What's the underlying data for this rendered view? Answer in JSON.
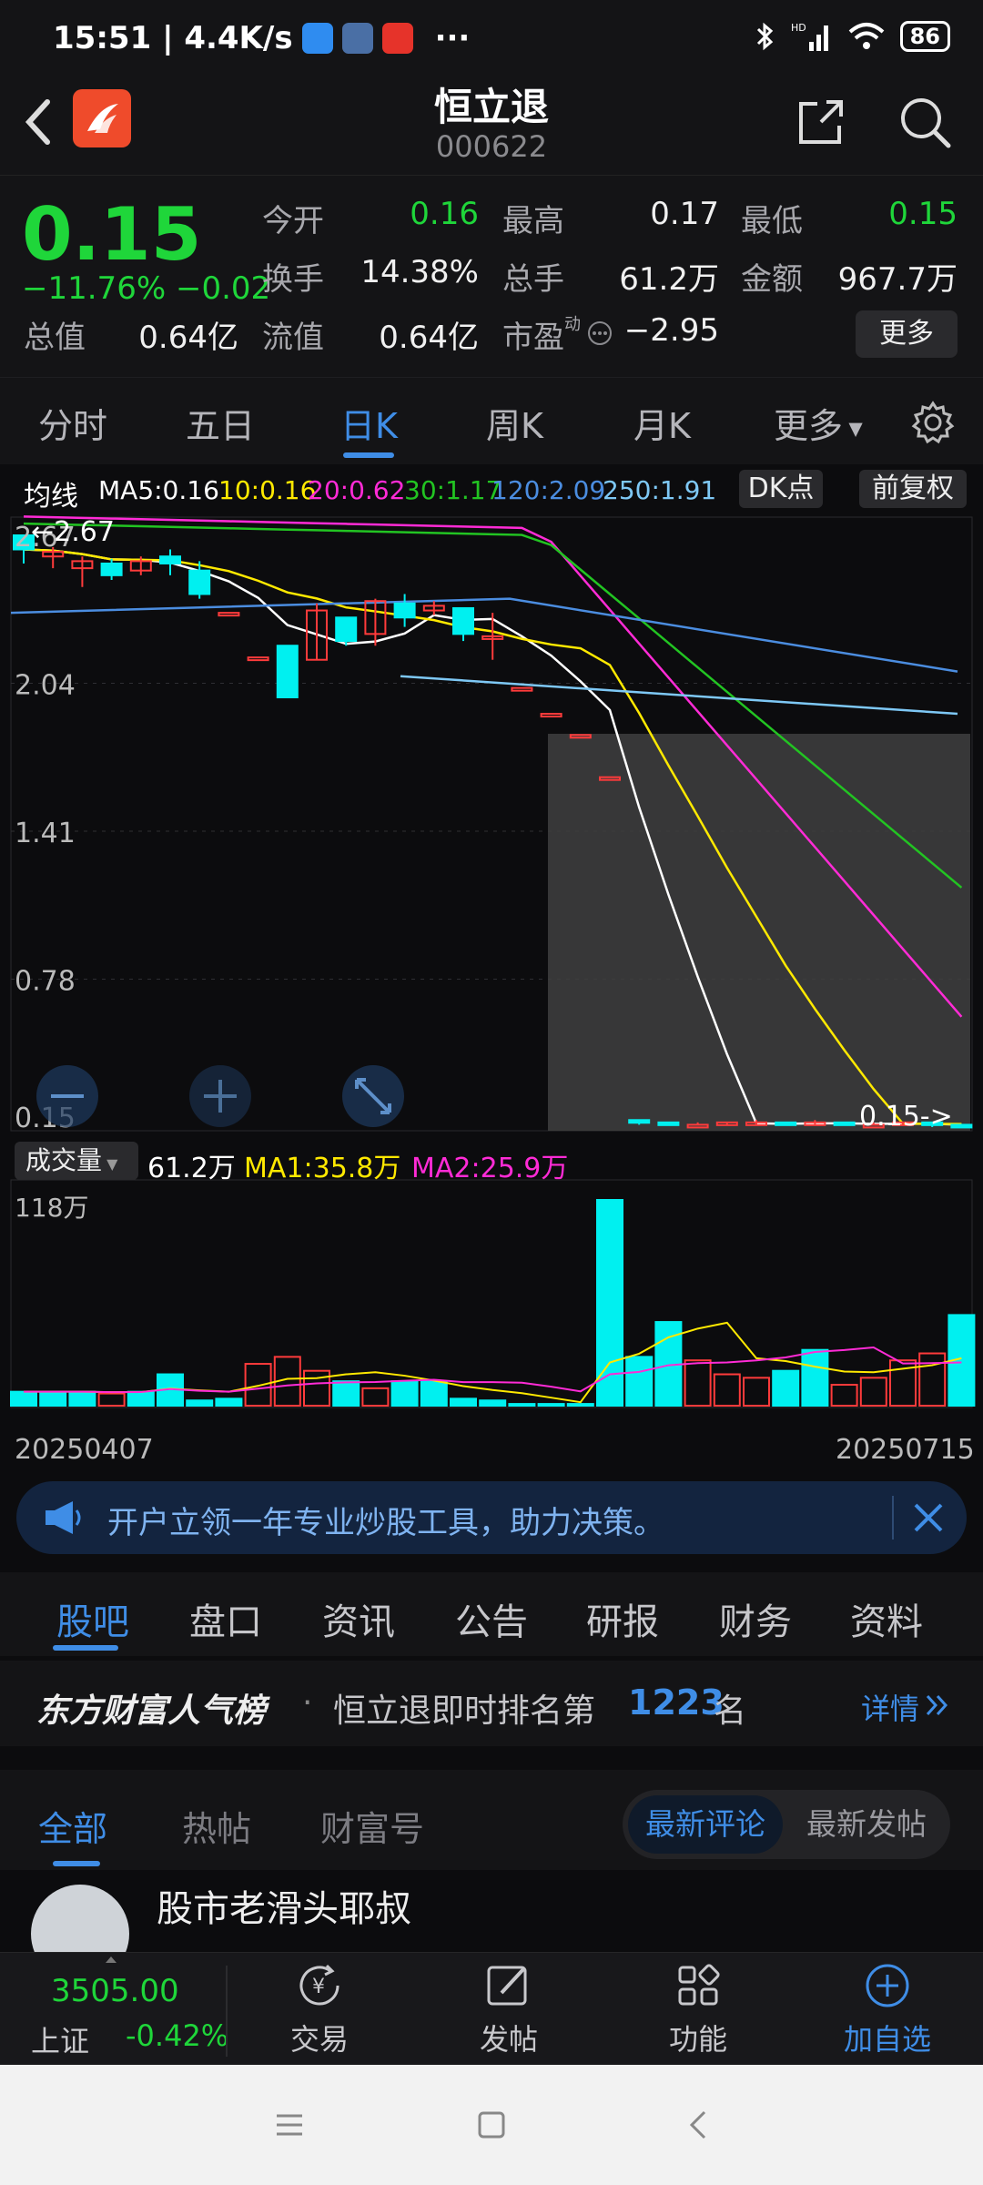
{
  "status": {
    "time_speed": "15:51 | 4.4K/s",
    "dots": "···",
    "battery": "86",
    "signal_tag": "HD"
  },
  "header": {
    "title": "恒立退",
    "code": "000622"
  },
  "quote": {
    "price": "0.15",
    "change_pct": "−11.76%",
    "change_abs": "−0.02",
    "open_label": "今开",
    "open": "0.16",
    "high_label": "最高",
    "high": "0.17",
    "low_label": "最低",
    "low": "0.15",
    "turnover_label": "换手",
    "turnover": "14.38%",
    "volume_label": "总手",
    "volume": "61.2万",
    "amount_label": "金额",
    "amount": "967.7万",
    "total_value_label": "总值",
    "total_value": "0.64亿",
    "float_value_label": "流值",
    "float_value": "0.64亿",
    "pe_label": "市盈",
    "pe_sup": "动",
    "pe": "−2.95",
    "more_label": "更多"
  },
  "ktabs": {
    "items": [
      "分时",
      "五日",
      "日K",
      "周K",
      "月K",
      "更多"
    ],
    "active": "日K"
  },
  "chart": {
    "ma_title": "均线",
    "ma5": "MA5:0.16",
    "ma10": "10:0.16",
    "ma20": "20:0.62",
    "ma30": "30:1.17",
    "ma120": "120:2.09",
    "ma250": "250:1.91",
    "dk_label": "DK点",
    "adjust_label": "前复权",
    "price_axis": [
      "2.67",
      "2.04",
      "1.41",
      "0.78",
      "0.15"
    ],
    "high_marker": "←2.67",
    "current_marker": "0.15->",
    "vol_selector": "成交量",
    "vol_value": "61.2万",
    "vol_ma1": "MA1:35.8万",
    "vol_ma2": "MA2:25.9万",
    "vol_axis_max": "118万",
    "date_start": "20250407",
    "date_end": "20250715",
    "colors": {
      "up": "#ff3b3b",
      "down": "#00f0f0",
      "ma5": "#ffffff",
      "ma10": "#ffe900",
      "ma20": "#ff2bd6",
      "ma30": "#22c422",
      "ma120": "#4b8de0",
      "ma250": "#7ec8f5"
    }
  },
  "chart_data": {
    "type": "candlestick",
    "ylim": [
      0.15,
      2.67
    ],
    "candles": [
      {
        "o": 2.67,
        "c": 2.61,
        "h": 2.67,
        "l": 2.55
      },
      {
        "o": 2.58,
        "c": 2.6,
        "h": 2.62,
        "l": 2.53
      },
      {
        "o": 2.53,
        "c": 2.56,
        "h": 2.58,
        "l": 2.45
      },
      {
        "o": 2.55,
        "c": 2.5,
        "h": 2.57,
        "l": 2.48
      },
      {
        "o": 2.52,
        "c": 2.56,
        "h": 2.58,
        "l": 2.5
      },
      {
        "o": 2.58,
        "c": 2.55,
        "h": 2.61,
        "l": 2.5
      },
      {
        "o": 2.52,
        "c": 2.42,
        "h": 2.56,
        "l": 2.4
      },
      {
        "o": 2.34,
        "c": 2.34,
        "h": 2.34,
        "l": 2.34
      },
      {
        "o": 2.15,
        "c": 2.15,
        "h": 2.15,
        "l": 2.15
      },
      {
        "o": 2.2,
        "c": 1.98,
        "h": 2.2,
        "l": 1.98
      },
      {
        "o": 2.14,
        "c": 2.35,
        "h": 2.38,
        "l": 2.14
      },
      {
        "o": 2.32,
        "c": 2.22,
        "h": 2.32,
        "l": 2.2
      },
      {
        "o": 2.25,
        "c": 2.39,
        "h": 2.4,
        "l": 2.2
      },
      {
        "o": 2.38,
        "c": 2.32,
        "h": 2.42,
        "l": 2.28
      },
      {
        "o": 2.35,
        "c": 2.37,
        "h": 2.39,
        "l": 2.33
      },
      {
        "o": 2.36,
        "c": 2.25,
        "h": 2.36,
        "l": 2.22
      },
      {
        "o": 2.24,
        "c": 2.24,
        "h": 2.34,
        "l": 2.14
      },
      {
        "o": 2.02,
        "c": 2.02,
        "h": 2.02,
        "l": 2.02
      },
      {
        "o": 1.91,
        "c": 1.91,
        "h": 1.91,
        "l": 1.91
      },
      {
        "o": 1.82,
        "c": 1.82,
        "h": 1.82,
        "l": 1.82
      },
      {
        "o": 1.64,
        "c": 1.64,
        "h": 1.64,
        "l": 1.64
      },
      {
        "o": 0.18,
        "c": 0.17,
        "h": 0.18,
        "l": 0.16
      },
      {
        "o": 0.17,
        "c": 0.16,
        "h": 0.17,
        "l": 0.16
      },
      {
        "o": 0.16,
        "c": 0.16,
        "h": 0.17,
        "l": 0.16
      },
      {
        "o": 0.16,
        "c": 0.17,
        "h": 0.17,
        "l": 0.16
      },
      {
        "o": 0.16,
        "c": 0.17,
        "h": 0.18,
        "l": 0.16
      },
      {
        "o": 0.17,
        "c": 0.16,
        "h": 0.17,
        "l": 0.16
      },
      {
        "o": 0.16,
        "c": 0.17,
        "h": 0.18,
        "l": 0.16
      },
      {
        "o": 0.17,
        "c": 0.16,
        "h": 0.17,
        "l": 0.16
      },
      {
        "o": 0.16,
        "c": 0.16,
        "h": 0.17,
        "l": 0.16
      },
      {
        "o": 0.16,
        "c": 0.17,
        "h": 0.17,
        "l": 0.16
      },
      {
        "o": 0.17,
        "c": 0.16,
        "h": 0.17,
        "l": 0.15
      },
      {
        "o": 0.16,
        "c": 0.15,
        "h": 0.16,
        "l": 0.15
      }
    ],
    "volume": [
      8,
      8,
      8,
      7,
      8,
      18,
      3,
      4,
      24,
      28,
      20,
      14,
      10,
      14,
      14,
      4,
      3,
      1,
      1,
      1,
      118,
      28,
      48,
      26,
      18,
      16,
      20,
      32,
      12,
      16,
      26,
      30,
      52
    ],
    "volume_up": [
      false,
      false,
      false,
      true,
      false,
      false,
      false,
      false,
      true,
      true,
      true,
      false,
      true,
      false,
      false,
      false,
      false,
      false,
      false,
      false,
      false,
      false,
      false,
      true,
      true,
      true,
      false,
      false,
      true,
      true,
      true,
      true,
      false
    ]
  },
  "banner": {
    "text": "开户立领一年专业炒股工具，助力决策。"
  },
  "subtabs": {
    "items": [
      "股吧",
      "盘口",
      "资讯",
      "公告",
      "研报",
      "财务",
      "资料"
    ],
    "active": "股吧"
  },
  "rank": {
    "brand": "东方财富人气榜",
    "text": "恒立退即时排名第",
    "number": "1223",
    "suffix": "名",
    "detail": "详情"
  },
  "filters": {
    "tabs": [
      "全部",
      "热帖",
      "财富号"
    ],
    "active": "全部",
    "sort_latest_comment": "最新评论",
    "sort_latest_post": "最新发帖"
  },
  "post": {
    "author": "股市老滑头耶叔"
  },
  "bottomnav": {
    "index_value": "3505.00",
    "index_name": "上证",
    "index_change": "-0.42%",
    "trade": "交易",
    "post": "发帖",
    "functions": "功能",
    "add_watch": "加自选"
  }
}
